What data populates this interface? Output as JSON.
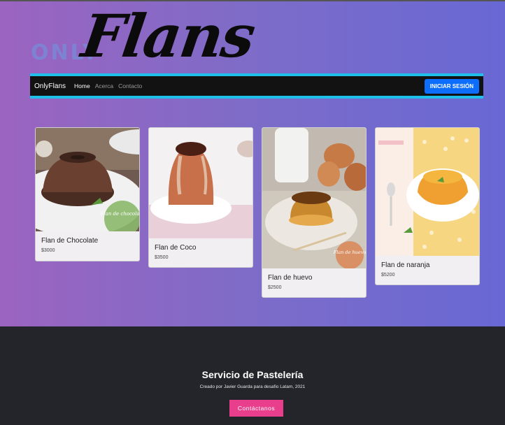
{
  "logo": {
    "only": "ONLY",
    "flans": "Flans"
  },
  "nav": {
    "brand": "OnlyFlans",
    "links": [
      "Home",
      "Acerca",
      "Contacto"
    ],
    "login": "INICIAR SESIÓN"
  },
  "cards": [
    {
      "title": "Flan de Chocolate",
      "price": "$3000",
      "badge": "Flan de chocolate"
    },
    {
      "title": "Flan de Coco",
      "price": "$3500"
    },
    {
      "title": "Flan de huevo",
      "price": "$2500",
      "badge": "Flan de huevo"
    },
    {
      "title": "Flan de naranja",
      "price": "$5200"
    }
  ],
  "footer": {
    "title": "Servicio de Pastelería",
    "subtitle": "Creado por Javier Guarda para desafio Latam, 2021",
    "button": "Contáctanos"
  },
  "colors": {
    "accent_cyan": "#1ec0ea",
    "primary_button": "#0d6efd",
    "contact_button": "#e83e8c",
    "footer_bg": "#23252b"
  }
}
